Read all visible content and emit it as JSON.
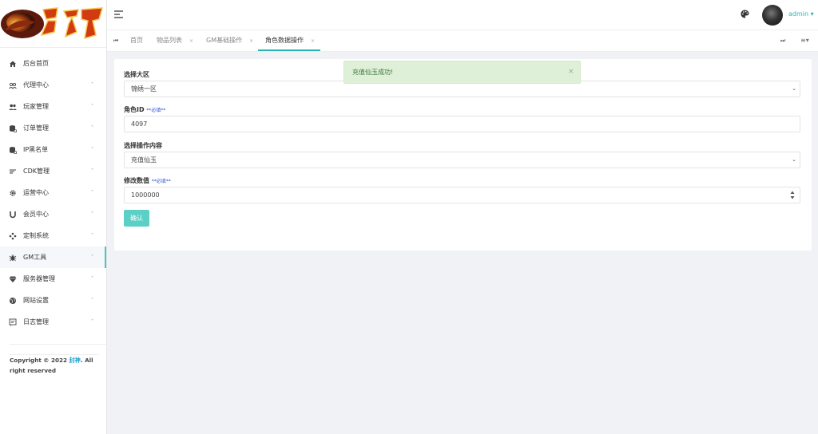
{
  "logo": {
    "text": "封神"
  },
  "sidebar": {
    "items": [
      {
        "label": "后台首页",
        "icon": "home-icon",
        "has_caret": false
      },
      {
        "label": "代理中心",
        "icon": "agents-icon",
        "has_caret": true
      },
      {
        "label": "玩家管理",
        "icon": "players-icon",
        "has_caret": true
      },
      {
        "label": "订单管理",
        "icon": "orders-icon",
        "has_caret": true
      },
      {
        "label": "IP黑名单",
        "icon": "blacklist-icon",
        "has_caret": true
      },
      {
        "label": "CDK管理",
        "icon": "cdk-icon",
        "has_caret": true
      },
      {
        "label": "运营中心",
        "icon": "gear-icon",
        "has_caret": true
      },
      {
        "label": "会员中心",
        "icon": "magnet-icon",
        "has_caret": true
      },
      {
        "label": "定制系统",
        "icon": "custom-icon",
        "has_caret": true
      },
      {
        "label": "GM工具",
        "icon": "bug-icon",
        "has_caret": true
      },
      {
        "label": "服务器管理",
        "icon": "diamond-icon",
        "has_caret": true
      },
      {
        "label": "网站设置",
        "icon": "globe-icon",
        "has_caret": true
      },
      {
        "label": "日志管理",
        "icon": "log-icon",
        "has_caret": true
      }
    ],
    "caret": "˅",
    "copyright_prefix": "Copyright © 2022 ",
    "copyright_brand": "封神",
    "copyright_suffix": ". All right reserved"
  },
  "header": {
    "user": "admin"
  },
  "tabs": {
    "prev_glyph": "⏮",
    "next_glyph": "⏭",
    "menu_glyph": "≡▾",
    "close_glyph": "×",
    "items": [
      {
        "label": "首页",
        "closable": false
      },
      {
        "label": "物品列表",
        "closable": true
      },
      {
        "label": "GM基础操作",
        "closable": true
      },
      {
        "label": "角色数据操作",
        "closable": true,
        "active": true
      }
    ]
  },
  "form": {
    "server_label": "选择大区",
    "server_value": "锦绣一区",
    "role_label": "角色ID",
    "role_required": "**必填**",
    "role_value": "4097",
    "op_label": "选择操作内容",
    "op_value": "充值仙玉",
    "amount_label": "修改数值",
    "amount_required": "**必填**",
    "amount_value": "1000000",
    "confirm_label": "确认",
    "chevron": "⌄"
  },
  "toast": {
    "message": "充值仙玉成功!",
    "close": "×"
  },
  "colors": {
    "accent": "#2ab5b5",
    "button": "#5ccfc6",
    "toast_bg": "#dff0d8",
    "toast_text": "#3c763d",
    "required": "#2a4fd6"
  }
}
